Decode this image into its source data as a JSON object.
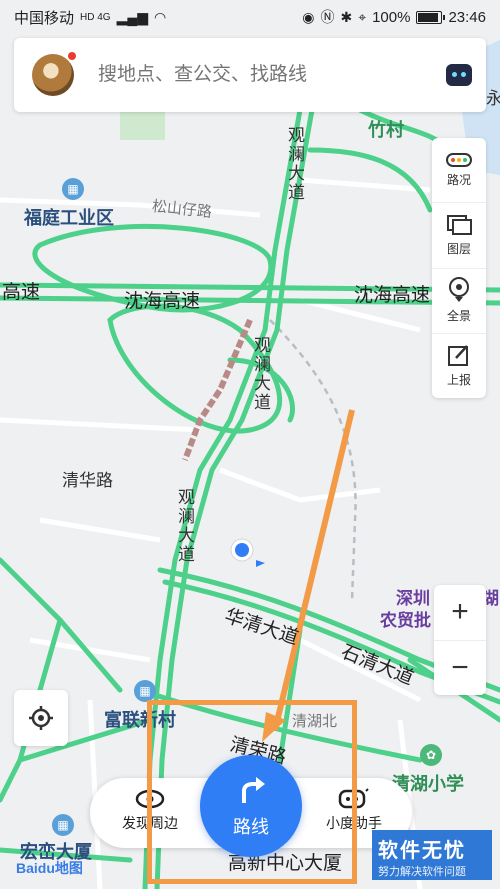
{
  "status_bar": {
    "carrier": "中国移动",
    "network": "HD 4G",
    "battery": "100%",
    "time": "23:46"
  },
  "search": {
    "placeholder": "搜地点、查公交、找路线"
  },
  "tools": [
    {
      "label": "路况",
      "icon": "traffic-icon"
    },
    {
      "label": "图层",
      "icon": "layers-icon"
    },
    {
      "label": "全景",
      "icon": "panorama-icon"
    },
    {
      "label": "上报",
      "icon": "report-icon"
    }
  ],
  "zoom": {
    "in": "+",
    "out": "−"
  },
  "map_labels": {
    "zhucun": "竹村",
    "futing": "福庭工业区",
    "songshan": "松山仔路",
    "gaosu_left": "高速",
    "shenhai1": "沈海高速",
    "shenhai2": "沈海高速",
    "qinghua": "清华路",
    "guanlan1": "观澜大道",
    "guanlan2": "观澜大道",
    "guanlan3": "观澜大道",
    "huaqing": "华清大道",
    "shiqing": "石清大道",
    "shenzhen_farm": "深圳",
    "nongmao": "农贸批",
    "fulian": "富联新村",
    "qinghubei": "清湖北",
    "qingrong": "清荣路",
    "qinghu_school": "清湖小学",
    "hongluan": "宏峦大厦",
    "tech_center": "高新中心大厦",
    "right_edge": "永",
    "hu": "湖"
  },
  "bottom_bar": {
    "discover": "发现周边",
    "route": "路线",
    "assistant": "小度助手"
  },
  "logos": {
    "baidu_map": "Baidu地图",
    "watermark_title": "软件无忧",
    "watermark_sub": "努力解决软件问题"
  },
  "colors": {
    "road_green": "#4dd08a",
    "route_blue": "#2f7ef5",
    "annotation_orange": "#f39a47",
    "map_bg": "#eef0f2"
  }
}
